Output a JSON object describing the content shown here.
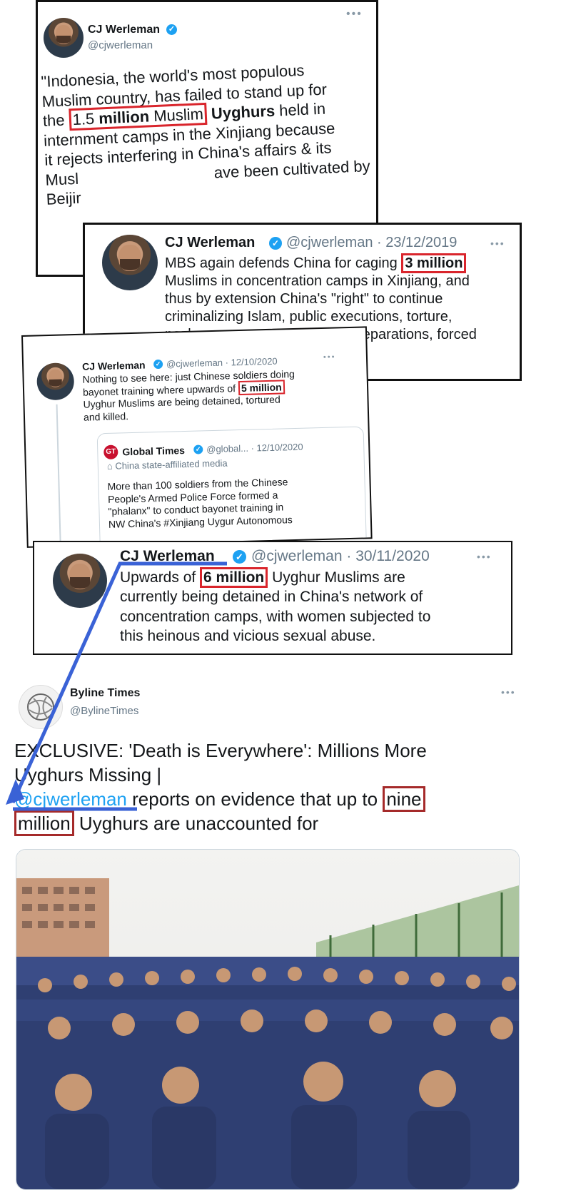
{
  "tweets": [
    {
      "name": "CJ Werleman",
      "handle": "@cjwerleman",
      "date": "",
      "lines": [
        "\"Indonesia, the world's most populous",
        "Muslim country, has failed to stand up for"
      ],
      "line3_pre": "the ",
      "line3_highlight_a": "1.5 ",
      "line3_highlight_b": "million",
      "line3_highlight_c": " Muslim",
      "line3_bold": " Uyghurs",
      "line3_post": " held in",
      "lines_after": [
        "internment camps in the Xinjiang because",
        "it rejects interfering in China's affairs & its"
      ],
      "cut_left_1": "Musl",
      "cut_right_1": "ave been cultivated by",
      "cut_left_2": "Beijir"
    },
    {
      "name": "CJ Werleman",
      "handle": "@cjwerleman",
      "date": "· 23/12/2019",
      "line1_pre": "MBS again defends China for caging ",
      "highlight": "3 million",
      "lines": [
        "Muslims in concentration camps in Xinjiang, and",
        "thus by extension China's \"right\" to continue",
        "criminalizing Islam, public executions, torture,"
      ],
      "cut_left": "pack ran",
      "cut_right": "eparations, forced"
    },
    {
      "name": "CJ Werleman",
      "handle": "@cjwerleman",
      "date": "· 12/10/2020",
      "line1": "Nothing to see here: just Chinese soldiers doing",
      "line2_pre": "bayonet training where upwards of ",
      "highlight": "5 million",
      "lines": [
        "Uyghur Muslims are being detained, tortured",
        "and killed."
      ],
      "quote": {
        "name": "Global Times",
        "handle": "@global...",
        "date": "· 12/10/2020",
        "badge": "GT",
        "label": "China state-affiliated media",
        "lines": [
          "More than 100 soldiers from the Chinese",
          "People's Armed Police Force formed a",
          "\"phalanx\" to conduct bayonet training in",
          "NW China's #Xinjiang Uygur Autonomous"
        ]
      }
    },
    {
      "name": "CJ Werleman",
      "handle": "@cjwerleman",
      "date": "· 30/11/2020",
      "line1_pre": "Upwards of ",
      "highlight": "6 million",
      "line1_post": " Uyghur Muslims are",
      "lines": [
        "currently being detained in China's network of",
        "concentration camps, with women subjected to",
        "this heinous and vicious sexual abuse."
      ]
    }
  ],
  "byline": {
    "name": "Byline Times",
    "handle": "@BylineTimes",
    "line1": "EXCLUSIVE: 'Death is Everywhere': Millions More",
    "line2": "Uyghurs Missing |",
    "mention": "@cjwerleman",
    "line3_post": " reports on evidence that up to ",
    "highlight_a": "nine",
    "highlight_b": "million",
    "line4_post": " Uyghurs are unaccounted for"
  },
  "colors": {
    "link": "#1da1f2",
    "highlight": "#d9252c",
    "arrow": "#3a62d6"
  }
}
